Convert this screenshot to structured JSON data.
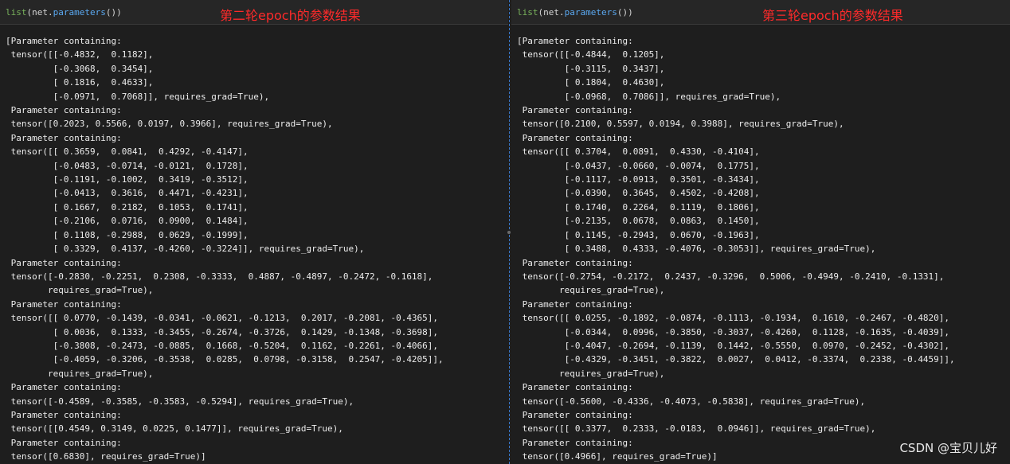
{
  "left": {
    "code": {
      "fn": "list",
      "open": "(net.",
      "attr": "parameters",
      "close": "())"
    },
    "title": "第二轮epoch的参数结果",
    "output": "[Parameter containing:\n tensor([[-0.4832,  0.1182],\n         [-0.3068,  0.3454],\n         [ 0.1816,  0.4633],\n         [-0.0971,  0.7068]], requires_grad=True),\n Parameter containing:\n tensor([0.2023, 0.5566, 0.0197, 0.3966], requires_grad=True),\n Parameter containing:\n tensor([[ 0.3659,  0.0841,  0.4292, -0.4147],\n         [-0.0483, -0.0714, -0.0121,  0.1728],\n         [-0.1191, -0.1002,  0.3419, -0.3512],\n         [-0.0413,  0.3616,  0.4471, -0.4231],\n         [ 0.1667,  0.2182,  0.1053,  0.1741],\n         [-0.2106,  0.0716,  0.0900,  0.1484],\n         [ 0.1108, -0.2988,  0.0629, -0.1999],\n         [ 0.3329,  0.4137, -0.4260, -0.3224]], requires_grad=True),\n Parameter containing:\n tensor([-0.2830, -0.2251,  0.2308, -0.3333,  0.4887, -0.4897, -0.2472, -0.1618],\n        requires_grad=True),\n Parameter containing:\n tensor([[ 0.0770, -0.1439, -0.0341, -0.0621, -0.1213,  0.2017, -0.2081, -0.4365],\n         [ 0.0036,  0.1333, -0.3455, -0.2674, -0.3726,  0.1429, -0.1348, -0.3698],\n         [-0.3808, -0.2473, -0.0885,  0.1668, -0.5204,  0.1162, -0.2261, -0.4066],\n         [-0.4059, -0.3206, -0.3538,  0.0285,  0.0798, -0.3158,  0.2547, -0.4205]],\n        requires_grad=True),\n Parameter containing:\n tensor([-0.4589, -0.3585, -0.3583, -0.5294], requires_grad=True),\n Parameter containing:\n tensor([[0.4549, 0.3149, 0.0225, 0.1477]], requires_grad=True),\n Parameter containing:\n tensor([0.6830], requires_grad=True)]"
  },
  "right": {
    "code": {
      "fn": "list",
      "open": "(net.",
      "attr": "parameters",
      "close": "())"
    },
    "title": "第三轮epoch的参数结果",
    "output": "[Parameter containing:\n tensor([[-0.4844,  0.1205],\n         [-0.3115,  0.3437],\n         [ 0.1804,  0.4630],\n         [-0.0968,  0.7086]], requires_grad=True),\n Parameter containing:\n tensor([0.2100, 0.5597, 0.0194, 0.3988], requires_grad=True),\n Parameter containing:\n tensor([[ 0.3704,  0.0891,  0.4330, -0.4104],\n         [-0.0437, -0.0660, -0.0074,  0.1775],\n         [-0.1117, -0.0913,  0.3501, -0.3434],\n         [-0.0390,  0.3645,  0.4502, -0.4208],\n         [ 0.1740,  0.2264,  0.1119,  0.1806],\n         [-0.2135,  0.0678,  0.0863,  0.1450],\n         [ 0.1145, -0.2943,  0.0670, -0.1963],\n         [ 0.3488,  0.4333, -0.4076, -0.3053]], requires_grad=True),\n Parameter containing:\n tensor([-0.2754, -0.2172,  0.2437, -0.3296,  0.5006, -0.4949, -0.2410, -0.1331],\n        requires_grad=True),\n Parameter containing:\n tensor([[ 0.0255, -0.1892, -0.0874, -0.1113, -0.1934,  0.1610, -0.2467, -0.4820],\n         [-0.0344,  0.0996, -0.3850, -0.3037, -0.4260,  0.1128, -0.1635, -0.4039],\n         [-0.4047, -0.2694, -0.1139,  0.1442, -0.5550,  0.0970, -0.2452, -0.4302],\n         [-0.4329, -0.3451, -0.3822,  0.0027,  0.0412, -0.3374,  0.2338, -0.4459]],\n        requires_grad=True),\n Parameter containing:\n tensor([-0.5600, -0.4336, -0.4073, -0.5838], requires_grad=True),\n Parameter containing:\n tensor([[ 0.3377,  0.2333, -0.0183,  0.0946]], requires_grad=True),\n Parameter containing:\n tensor([0.4966], requires_grad=True)]"
  },
  "watermark": "CSDN @宝贝儿好"
}
